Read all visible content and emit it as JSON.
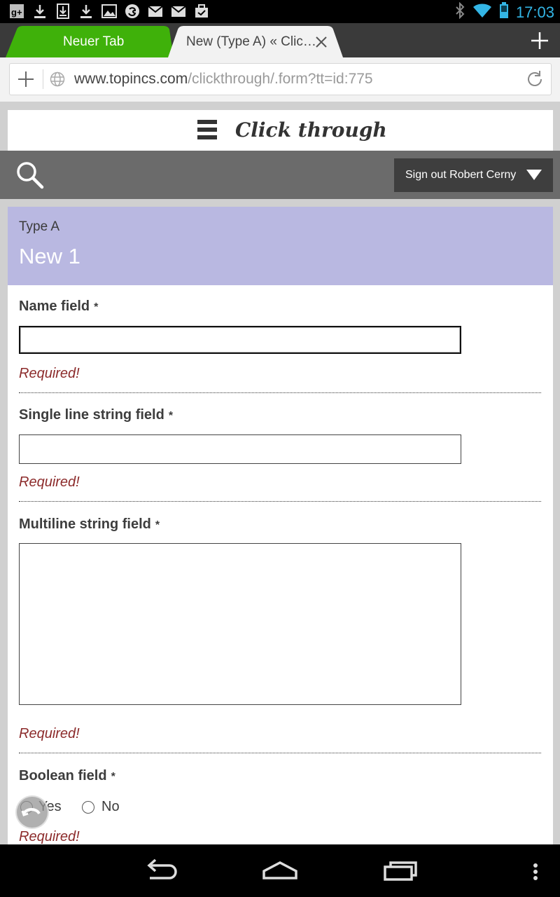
{
  "status_bar": {
    "time": "17:03",
    "left_icons": [
      "google-plus-icon",
      "download-icon",
      "download-box-icon",
      "download-icon",
      "image-icon",
      "circle-app-icon",
      "gmail-icon",
      "gmail-icon",
      "briefcase-check-icon"
    ],
    "right_icons": [
      "bluetooth-icon",
      "wifi-icon",
      "battery-icon"
    ]
  },
  "browser": {
    "tabs": [
      {
        "label": "Neuer Tab",
        "active": false,
        "color": "#3fb10a"
      },
      {
        "label": "New (Type A) « Clic…",
        "active": true
      }
    ],
    "url_domain": "www.topincs.com",
    "url_path": "/clickthrough/.form?tt=id:775"
  },
  "site": {
    "title": "Click through",
    "signout_label": "Sign out Robert Cerny"
  },
  "form": {
    "type_label": "Type A",
    "instance_title": "New 1",
    "required_marker": "*",
    "required_msg": "Required!",
    "fields": {
      "name": {
        "label": "Name field",
        "value": ""
      },
      "single_line": {
        "label": "Single line string field",
        "value": ""
      },
      "multiline": {
        "label": "Multiline string field",
        "value": ""
      },
      "boolean": {
        "label": "Boolean field",
        "options": [
          "Yes",
          "No"
        ],
        "selected": null
      }
    }
  },
  "colors": {
    "header_bg": "#b9b8e1",
    "required_text": "#8c2b2b",
    "clock": "#33b5e5",
    "toolbar": "#6b6b6b"
  }
}
